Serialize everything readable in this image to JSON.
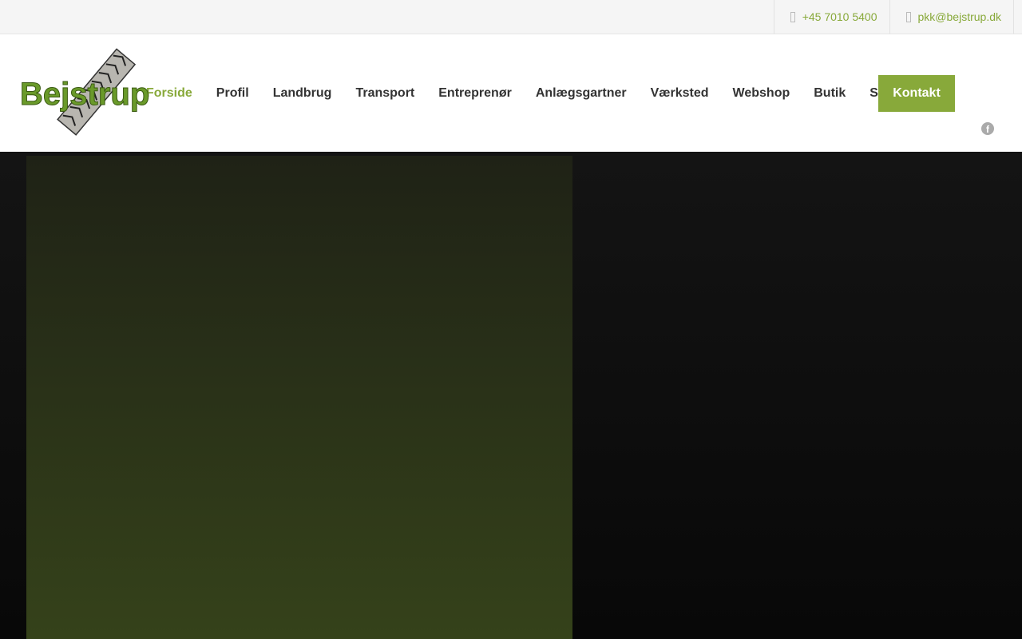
{
  "topbar": {
    "phone": "+45 7010 5400",
    "email": "pkk@bejstrup.dk",
    "phone_icon": "phone-icon",
    "email_icon": "envelope-icon"
  },
  "logo": {
    "text": "Bejstrup"
  },
  "nav": {
    "items": [
      {
        "label": "Forside"
      },
      {
        "label": "Profil"
      },
      {
        "label": "Landbrug"
      },
      {
        "label": "Transport"
      },
      {
        "label": "Entreprenør"
      },
      {
        "label": "Anlægsgartner"
      },
      {
        "label": "Værksted"
      },
      {
        "label": "Webshop"
      },
      {
        "label": "Butik"
      },
      {
        "label": "Skilte"
      }
    ],
    "cta": "Kontakt",
    "social_icon": "facebook-icon"
  },
  "colors": {
    "accent": "#88a93a",
    "text": "#333333"
  }
}
